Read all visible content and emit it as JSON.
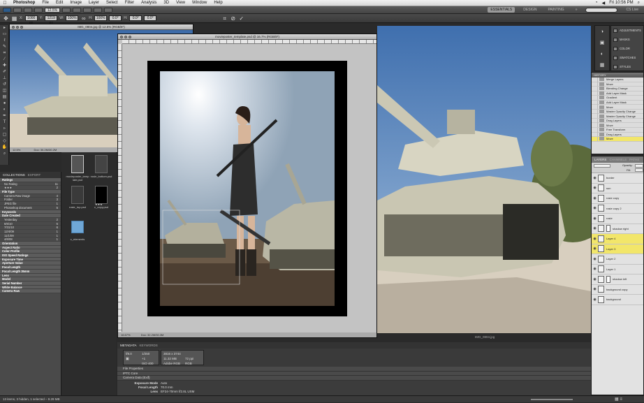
{
  "menubar": {
    "app_name": "Photoshop",
    "items": [
      "File",
      "Edit",
      "Image",
      "Layer",
      "Select",
      "Filter",
      "Analysis",
      "3D",
      "View",
      "Window",
      "Help"
    ],
    "clock": "Fri 10:56 PM"
  },
  "appbar": {
    "zoom": "12.5%",
    "workspaces": [
      "ESSENTIALS",
      "DESIGN",
      "PAINTING"
    ],
    "active_workspace": "ESSENTIALS",
    "cs_live": "CS Live"
  },
  "optbar": {
    "width_value": "1000 px",
    "height_value": "1219 px",
    "x_value": "0.0°",
    "y_value": "0.0°"
  },
  "doc_small": {
    "title": "IMG_0804.jpg @ 12.5% (RGB/8*)",
    "zoom": "12.5%",
    "doc_size": "Doc: 30.2M/30.2M"
  },
  "doc_main": {
    "title": "movieposter_template.psd @ 16.7% (RGB/8*)",
    "zoom": "16.67%",
    "doc_size": "Doc: 32.2M/30.3M"
  },
  "bg_doc": {
    "filename": "IMG_0804.jpg"
  },
  "bridge": {
    "tabs": [
      "COLLECTIONS",
      "EXPORT"
    ],
    "filter_rows": [
      {
        "label": "Ratings",
        "count": "",
        "header": true
      },
      {
        "label": "No Rating",
        "count": "11",
        "header": false
      },
      {
        "label": "★★★",
        "count": "2",
        "header": false
      },
      {
        "label": "File Type",
        "count": "",
        "header": true
      },
      {
        "label": "Camera Raw image",
        "count": "4",
        "header": false
      },
      {
        "label": "Folder",
        "count": "3",
        "header": false
      },
      {
        "label": "JPEG file",
        "count": "1",
        "header": false
      },
      {
        "label": "Photoshop document",
        "count": "5",
        "header": false
      },
      {
        "label": "Keywords",
        "count": "",
        "header": true
      },
      {
        "label": "Date Created",
        "count": "",
        "header": true
      },
      {
        "label": "Yesterday",
        "count": "2",
        "header": false
      },
      {
        "label": "8/6/10",
        "count": "5",
        "header": false
      },
      {
        "label": "7/31/10",
        "count": "6",
        "header": false
      },
      {
        "label": "12/4/09",
        "count": "1",
        "header": false
      },
      {
        "label": "11/1/09",
        "count": "1",
        "header": false
      },
      {
        "label": "4/6/08",
        "count": "1",
        "header": false
      },
      {
        "label": "Orientation",
        "count": "",
        "header": true
      },
      {
        "label": "Aspect Ratio",
        "count": "",
        "header": true
      },
      {
        "label": "Color Profile",
        "count": "",
        "header": true
      },
      {
        "label": "ISO Speed Ratings",
        "count": "",
        "header": true
      },
      {
        "label": "Exposure Time",
        "count": "",
        "header": true
      },
      {
        "label": "Aperture Value",
        "count": "",
        "header": true
      },
      {
        "label": "Focal Length",
        "count": "",
        "header": true
      },
      {
        "label": "Focal Length 35mm",
        "count": "",
        "header": true
      },
      {
        "label": "Lens",
        "count": "",
        "header": true
      },
      {
        "label": "Model",
        "count": "",
        "header": true
      },
      {
        "label": "Serial Number",
        "count": "",
        "header": true
      },
      {
        "label": "White Balance",
        "count": "",
        "header": true
      },
      {
        "label": "Camera Raw",
        "count": "",
        "header": true
      }
    ],
    "thumbs": [
      {
        "caption": "movieposter_temp\nlate.psd"
      },
      {
        "caption": "rosie_bottom.psd"
      },
      {
        "caption": "rosie_top.psd"
      },
      {
        "caption": "c_copy.psd"
      },
      {
        "caption": "c_elements"
      }
    ],
    "stars": "★★★",
    "status": "13 items, 3 hidden, 1 selected – 9.29 MB"
  },
  "metadata": {
    "tabs": [
      "METADATA",
      "KEYWORDS"
    ],
    "aperture": "f/8.0",
    "shutter": "1/250",
    "exposure_comp": "+1",
    "iso": "ISO 400",
    "dimensions": "3816 x 3744",
    "file_size": "11.32 MB",
    "resolution": "72 ppi",
    "color_profile": "Adobe RGB",
    "color_mode": "RGB",
    "sections": [
      "File Properties",
      "IPTC Core",
      "Camera Data (Exif)"
    ],
    "exposure_mode_label": "Exposure Mode",
    "exposure_mode_value": "Auto",
    "focal_length_label": "Focal Length",
    "focal_length_value": "70.0 mm",
    "lens_label": "Lens",
    "lens_value": "EF24-70mm f/2.8L USM"
  },
  "panels": {
    "icons": [
      "ADJUSTMENTS",
      "MASKS",
      "COLOR",
      "SWATCHES",
      "STYLES"
    ],
    "history_title": "HISTORY",
    "history_items": [
      {
        "label": "Merge Layers",
        "selected": false
      },
      {
        "label": "Move",
        "selected": false
      },
      {
        "label": "Blending Change",
        "selected": false
      },
      {
        "label": "Add Layer Mask",
        "selected": false
      },
      {
        "label": "Gradient",
        "selected": false
      },
      {
        "label": "Add Layer Mask",
        "selected": false
      },
      {
        "label": "Move",
        "selected": false
      },
      {
        "label": "Master Opacity Change",
        "selected": false
      },
      {
        "label": "Master Opacity Change",
        "selected": false
      },
      {
        "label": "Drag Layers",
        "selected": false
      },
      {
        "label": "Move",
        "selected": false
      },
      {
        "label": "Free Transform",
        "selected": false
      },
      {
        "label": "Drag Layers",
        "selected": false
      },
      {
        "label": "Move",
        "selected": true
      }
    ],
    "layer_tabs": [
      "LAYERS",
      "CHANNELS",
      "PATHS"
    ],
    "opacity_label": "Opacity:",
    "fill_label": "Fill:",
    "layers": [
      {
        "name": "border",
        "selected": false,
        "mask": false
      },
      {
        "name": "sun",
        "selected": false,
        "mask": false
      },
      {
        "name": "rosie copy",
        "selected": false,
        "mask": false
      },
      {
        "name": "rosie copy 2",
        "selected": false,
        "mask": false
      },
      {
        "name": "rosie",
        "selected": false,
        "mask": false
      },
      {
        "name": "shadow right",
        "selected": false,
        "mask": true
      },
      {
        "name": "Layer 4",
        "selected": true,
        "mask": false
      },
      {
        "name": "Layer 3",
        "selected": true,
        "mask": false
      },
      {
        "name": "Layer 2",
        "selected": false,
        "mask": false
      },
      {
        "name": "Layer 1",
        "selected": false,
        "mask": false
      },
      {
        "name": "shadow left",
        "selected": false,
        "mask": true
      },
      {
        "name": "background copy",
        "selected": false,
        "mask": false
      },
      {
        "name": "background",
        "selected": false,
        "mask": false
      }
    ]
  }
}
